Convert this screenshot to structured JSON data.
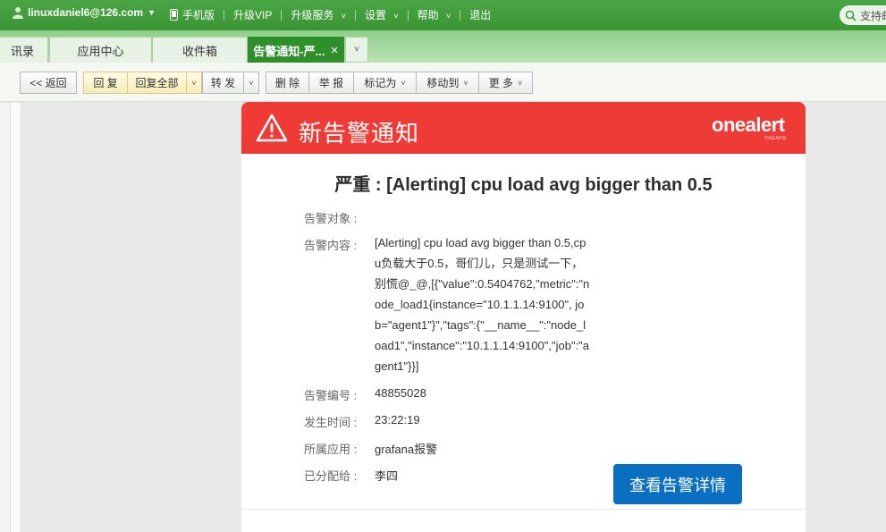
{
  "topbar": {
    "user": "linuxdaniel6@126.com",
    "links": [
      "手机版",
      "升级VIP",
      "升级服务",
      "设置",
      "帮助",
      "退出"
    ],
    "search_label": "支持邮"
  },
  "tabs": [
    {
      "label": "讯录"
    },
    {
      "label": "应用中心"
    },
    {
      "label": "收件箱"
    },
    {
      "label": "告警通知-严..."
    }
  ],
  "toolbar": {
    "back": "<< 返回",
    "reply": "回 复",
    "reply_all": "回复全部",
    "forward": "转 发",
    "delete": "删 除",
    "report": "举 报",
    "mark_as": "标记为",
    "move_to": "移动到",
    "more": "更 多"
  },
  "header": {
    "title": "新告警通知",
    "logo": "onealert",
    "logo_sub": "ONEAPM"
  },
  "alert": {
    "title": "严重 : [Alerting] cpu load avg bigger than 0.5",
    "target_label": "告警对象 :",
    "target_value": "",
    "content_label": "告警内容 :",
    "content_value": "[Alerting] cpu load avg bigger than 0.5,cp\nu负载大于0.5，哥们儿，只是测试一下，\n别慌@_@,[{\"value\":0.5404762,\"metric\":\"n\node_load1{instance=\"10.1.1.14:9100\", jo\nb=\"agent1\"}\",\"tags\":{\"__name__\":\"node_l\noad1\",\"instance\":\"10.1.1.14:9100\",\"job\":\"a\ngent1\"}}]",
    "id_label": "告警编号 :",
    "id_value": "48855028",
    "time_label": "发生时间 :",
    "time_value": "23:22:19",
    "app_label": "所属应用 :",
    "app_value": "grafana报警",
    "assignee_label": "已分配给 :",
    "assignee_value": "李四",
    "view_button": "查看告警详情"
  },
  "colors": {
    "nav_green": "#3b9535",
    "header_red": "#ef3b36",
    "button_blue": "#0b6fc1"
  }
}
